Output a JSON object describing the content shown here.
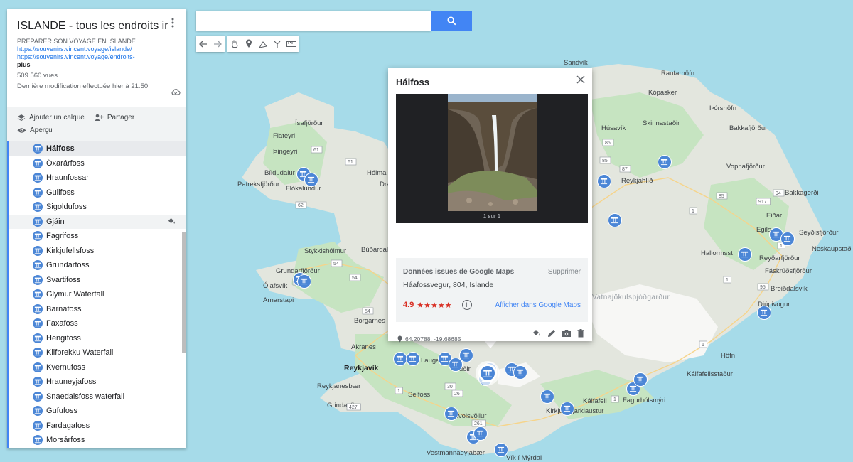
{
  "panel": {
    "title": "ISLANDE - tous les endroits indis...",
    "description": "PREPARER SON VOYAGE EN ISLANDE",
    "links": [
      "https://souvenirs.vincent.voyage/islande/",
      "https://souvenirs.vincent.voyage/endroits-"
    ],
    "more": "plus",
    "views": "509 560 vues",
    "last_modified": "Dernière modification effectuée hier à 21:50",
    "add_layer": "Ajouter un calque",
    "share": "Partager",
    "preview": "Aperçu",
    "items": [
      "Háifoss",
      "Öxarárfoss",
      "Hraunfossar",
      "Gullfoss",
      "Sigoldufoss",
      "Gjáin",
      "Fagrifoss",
      "Kirkjufellsfoss",
      "Grundarfoss",
      "Svartifoss",
      "Glymur Waterfall",
      "Barnafoss",
      "Faxafoss",
      "Hengifoss",
      "Klifbrekku Waterfall",
      "Kvernufoss",
      "Hrauneyjafoss",
      "Snaedalsfoss waterfall",
      "Gufufoss",
      "Fardagafoss",
      "Morsárfoss"
    ]
  },
  "search": {
    "placeholder": ""
  },
  "icons": {
    "search": "search-icon",
    "undo": "undo-icon",
    "redo": "redo-icon",
    "pan": "hand-icon",
    "marker": "marker-icon",
    "line": "draw-line-icon",
    "route": "route-icon",
    "measure": "ruler-icon",
    "waterfall": "waterfall-icon"
  },
  "card": {
    "title": "Háifoss",
    "photo_counter": "1 sur 1",
    "source": "Données issues de Google Maps",
    "delete": "Supprimer",
    "address": "Háafossvegur, 804, Islande",
    "rating": "4.9",
    "stars": "★★★★★",
    "info": "i",
    "open_in_maps": "Afficher dans Google Maps",
    "coords": "64.20788, -19.68685"
  },
  "map": {
    "labels": {
      "sandvik": "Sandvik",
      "raufarhofn": "Raufarhöfn",
      "kopasker": "Kópasker",
      "thorshofn": "Þórshöfn",
      "husavik": "Húsavík",
      "skinnastadir": "Skinnastaðir",
      "bakkafjordur": "Bakkafjörður",
      "isafjordur": "Ísafjörður",
      "flateyri": "Flateyri",
      "thingeyri": "Þingeyri",
      "bildudalur": "Bíldudalur",
      "patreksfjordur": "Patreksfjörður",
      "flokalundur": "Flókalundur",
      "holma": "Hólma",
      "dra": "Drá",
      "reykjahlid": "Reykjahlíð",
      "vopnafjordur": "Vopnafjörður",
      "bakkagerdi": "Bakkagerði",
      "eidar": "Eiðar",
      "egils": "Egils",
      "seydisfjordur": "Seyðisfjörður",
      "neskaupstadur": "Neskaupstað",
      "hallormsst": "Hallormsst",
      "reydarfjordur": "Reyðarfjörður",
      "faskrudsfjordur": "Fáskrúðsfjörður",
      "breiddalsvik": "Breiðdalsvík",
      "djupivogur": "Djúpivogur",
      "vatnajokull": "Vatnajökulsþjóðgarður",
      "stykkisholmur": "Stykkishólmur",
      "budardalur": "Búðardal",
      "grundarfjordur": "Grundarfjörður",
      "olafsvik": "Ólafsvík",
      "arnarstapi": "Arnarstapi",
      "borgarnes": "Borgarnes",
      "akranes": "Akranes",
      "reykjavik": "Reykjavík",
      "laugar": "Laugar",
      "fludir": "Flúðir",
      "reykjanesbaer": "Reykjanesbær",
      "selfoss": "Selfoss",
      "grindavik": "Grindavík",
      "hvolsvollur": "Hvolsvöllur",
      "vestmannaeyjabaer": "Vestmannaeyjabær",
      "vik": "Vík í Mýrdal",
      "hofn": "Höfn",
      "kalfafellsstadur": "Kálfafellsstaður",
      "kalfafell": "Kálfafell",
      "kirkjubaejarklaustur": "Kirkjubæjarklaustur",
      "fagurholsmyri": "Fagurhólsmýri"
    },
    "roads": [
      "85",
      "61",
      "61",
      "62",
      "85",
      "87",
      "85",
      "94",
      "917",
      "1",
      "1",
      "54",
      "54",
      "55",
      "54",
      "1",
      "30",
      "26",
      "427",
      "261",
      "1",
      "1",
      "1",
      "95"
    ]
  },
  "colors": {
    "water": "#a6dbe9",
    "land": "#e8eae3",
    "green": "#c6e4c1",
    "ice": "#f7f7f5",
    "accent": "#4285f4",
    "marker": "#4b86d6"
  }
}
